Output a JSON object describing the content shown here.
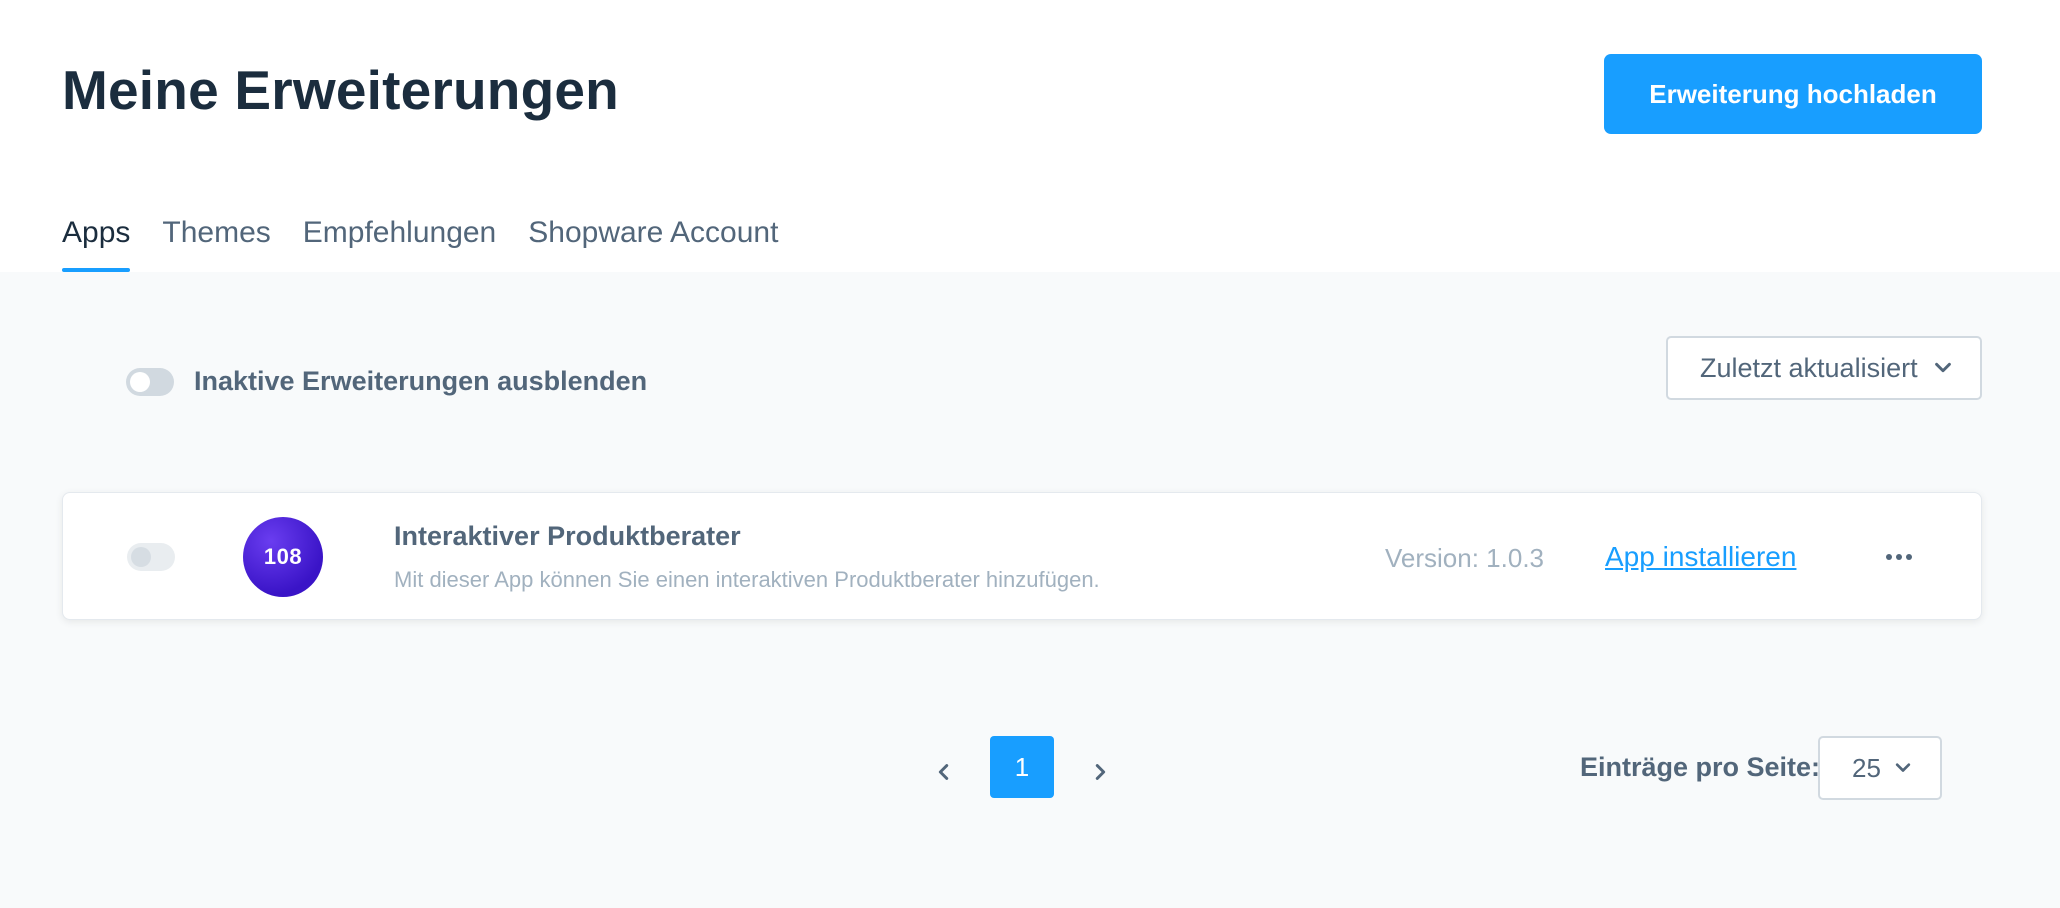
{
  "header": {
    "title": "Meine Erweiterungen",
    "upload_button": "Erweiterung hochladen"
  },
  "tabs": [
    {
      "label": "Apps",
      "active": true
    },
    {
      "label": "Themes",
      "active": false
    },
    {
      "label": "Empfehlungen",
      "active": false
    },
    {
      "label": "Shopware Account",
      "active": false
    }
  ],
  "filters": {
    "hide_inactive_label": "Inaktive Erweiterungen ausblenden",
    "hide_inactive_on": false,
    "sort_selected": "Zuletzt aktualisiert"
  },
  "extensions": [
    {
      "logo_text": "108",
      "name": "Interaktiver Produktberater",
      "description": "Mit dieser App können Sie einen interaktiven Produktberater hinzufügen.",
      "version": "Version: 1.0.3",
      "action_label": "App installieren",
      "active": false
    }
  ],
  "pagination": {
    "current_page": "1",
    "per_page_label": "Einträge pro Seite:",
    "per_page_value": "25"
  },
  "colors": {
    "primary": "#189eff",
    "title": "#1b2d3e",
    "text": "#52667a",
    "muted": "#a1b1bf",
    "content_bg": "#f8fafb"
  },
  "icons": {
    "sort_chevron": "chevron-down-icon",
    "per_page_chevron": "chevron-down-icon",
    "prev": "chevron-left-icon",
    "next": "chevron-right-icon",
    "more": "more-dots-icon"
  }
}
